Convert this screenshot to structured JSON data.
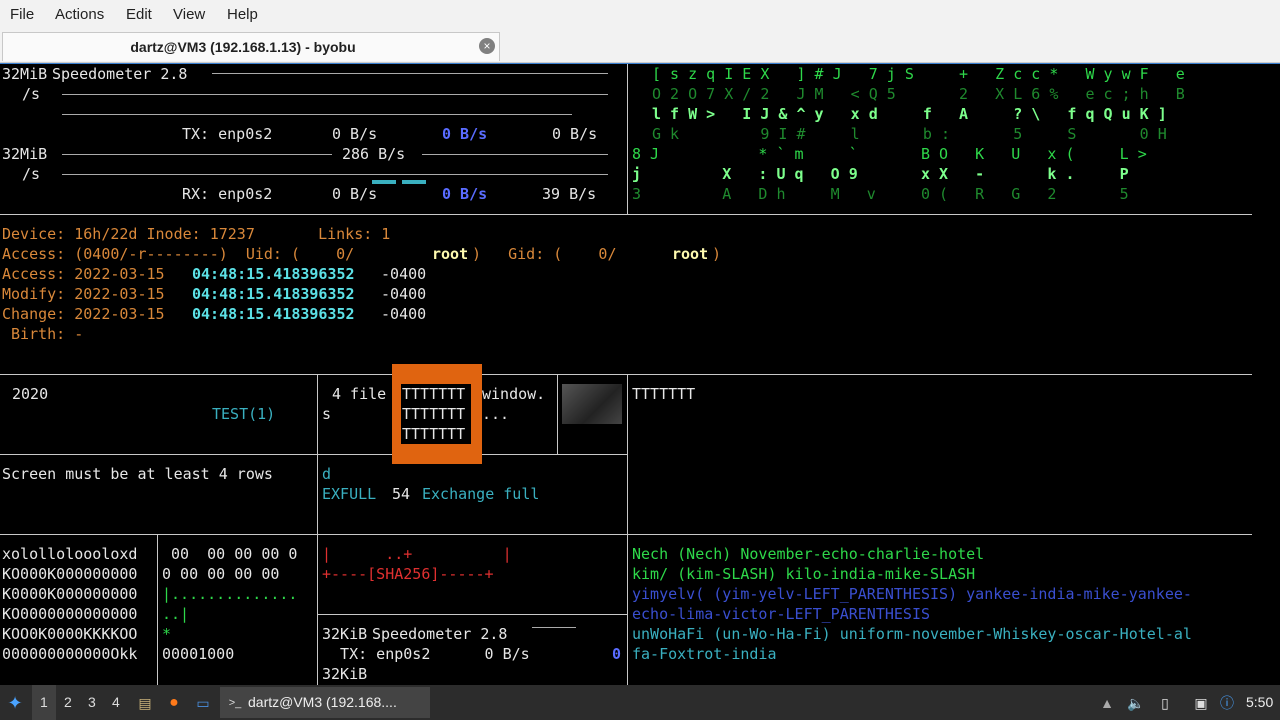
{
  "menu": {
    "file": "File",
    "actions": "Actions",
    "edit": "Edit",
    "view": "View",
    "help": "Help"
  },
  "tab": {
    "title": "dartz@VM3 (192.168.1.13) - byobu",
    "close": "×"
  },
  "speed": {
    "unit_top": "32MiB",
    "title": "Speedometer 2.8",
    "per_s": "/s",
    "tx_label": "TX: enp0s2",
    "tx_v1": "0 B/s",
    "tx_v2": "0 B/s",
    "tx_v3": "0 B/s",
    "unit_mid": "32MiB",
    "rx_peak": "286 B/s",
    "rx_label": "RX: enp0s2",
    "rx_v1": "0 B/s",
    "rx_v2": "0 B/s",
    "rx_v3": "39 B/s"
  },
  "matrix": [
    "[ s z q I E X   ] # J   7 j S     +   Z c c *   W y w F   e",
    "O 2 O 7 X / 2   J M   < Q 5       2   X L 6 %   e c ; h   B",
    "l f W >   I J & ^ y   x d     f   A     ? \\   f q Q u K ]",
    "G k         9 I #     l       b :       5     S       0 H",
    "8 J           * ` m     `       B O   K   U   x (     L >",
    "j         X   : U q   O 9       x X   -       k .     P",
    "3         A   D h     M   v     0 (   R   G   2       5"
  ],
  "stat": {
    "device": "Device: 16h/22d Inode: 17237       Links: 1",
    "access_perm": "Access: (0400/-r--------)  Uid: (    0/",
    "root1": "root",
    "gid": ")   Gid: (    0/",
    "root2": "root",
    "close_paren": ")",
    "access_lbl": "Access: 2022-03-15 ",
    "modify_lbl": "Modify: 2022-03-15 ",
    "change_lbl": "Change: 2022-03-15 ",
    "time": "04:48:15.418396352",
    "tz": " -0400",
    "birth": " Birth: -"
  },
  "panes": {
    "year": "2020",
    "test": "TEST(1)",
    "files": "4 file",
    "files_s": "s",
    "t_line": "TTTTTTT",
    "window": "window.",
    "dots": "...",
    "right_t": "TTTTTTT",
    "screen_msg": "Screen must be at least 4 rows",
    "d": "d",
    "exfull": "EXFULL",
    "exfull_n": "54",
    "exfull_desc": "Exchange full",
    "ascii_left": [
      "xololloloooloxd",
      "KO000K000000000",
      "K0000K000000000",
      "KO0000000000000",
      "KOO0K0000KKKKOO",
      "000000000000Okk"
    ],
    "hex": [
      " 00  00 00 00 0",
      "0 00 00 00 00",
      "|..............",
      "..|",
      "*",
      "00001000"
    ],
    "sha_line1": "|      ..+          |",
    "sha_line2": "+----[SHA256]-----+",
    "speed2_unit": "32KiB",
    "speed2_title": "Speedometer 2.8",
    "speed2_tx": "  TX: enp0s2      0 B/s",
    "speed2_zero": "0",
    "speed2_unit2": "32KiB",
    "nato1": "Nech (Nech) November-echo-charlie-hotel",
    "nato2": "kim/ (kim-SLASH) kilo-india-mike-SLASH",
    "nato3a": "yimyelv( (yim-yelv-LEFT_PARENTHESIS) yankee-india-mike-yankee-",
    "nato3b": "echo-lima-victor-LEFT_PARENTHESIS",
    "nato4a": "unWoHaFi (un-Wo-Ha-Fi) uniform-november-Whiskey-oscar-Hotel-al",
    "nato4b": "fa-Foxtrot-india"
  },
  "taskbar": {
    "ws1": "1",
    "ws2": "2",
    "ws3": "3",
    "ws4": "4",
    "task": "dartz@VM3 (192.168....",
    "clock": "5:50"
  },
  "colors": {
    "accent": "#3a7fd0",
    "orange": "#e06410",
    "green": "#2ed84a",
    "cyan": "#5ce1e6"
  }
}
